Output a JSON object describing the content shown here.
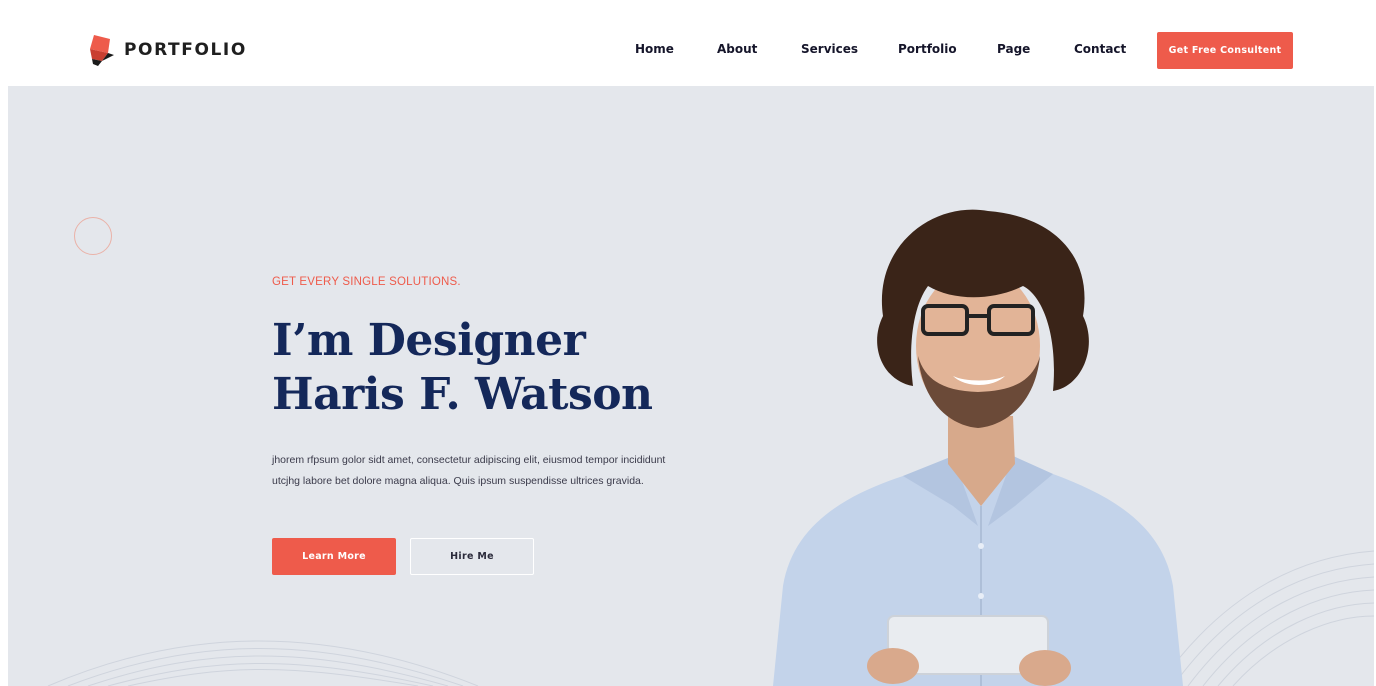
{
  "brand": {
    "name": "PORTFOLIO",
    "accent": "#ee5b4b",
    "accent_dark": "#1b1b1b"
  },
  "nav": {
    "items": [
      {
        "label": "Home"
      },
      {
        "label": "About"
      },
      {
        "label": "Services"
      },
      {
        "label": "Portfolio"
      },
      {
        "label": "Page"
      },
      {
        "label": "Contact"
      }
    ],
    "cta_label": "Get Free Consultent"
  },
  "hero": {
    "eyebrow": "GET EVERY SINGLE SOLUTIONS.",
    "title_line1": "I’m Designer",
    "title_line2": "Haris F. Watson",
    "description": "jhorem rfpsum golor sidt amet, consectetur adipiscing elit, eiusmod tempor incididunt utcjhg labore bet dolore magna aliqua. Quis ipsum suspendisse ultrices gravida.",
    "primary_button": "Learn More",
    "secondary_button": "Hire Me",
    "title_color": "#14285a",
    "background": "#e4e7ec"
  },
  "icons": [
    "logo-icon",
    "decorative-circle",
    "wave-lines",
    "person-photo"
  ]
}
